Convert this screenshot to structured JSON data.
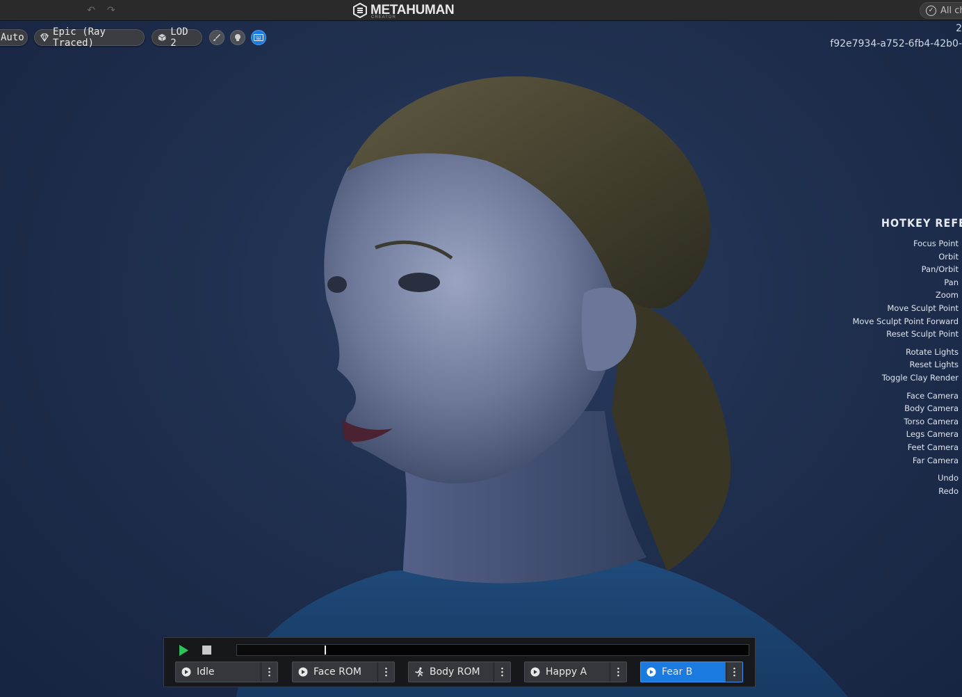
{
  "app": {
    "brand": "METAHUMAN",
    "brand_sub": "CREATOR",
    "save_status": "All ch"
  },
  "toolbar": {
    "render_mode": "Auto",
    "quality": "Epic (Ray Traced)",
    "lod": "LOD 2",
    "icons": [
      "brush-icon",
      "head-icon",
      "keyboard-icon"
    ]
  },
  "viewport": {
    "id_top": "2",
    "asset_id": "f92e7934-a752-6fb4-42b0-"
  },
  "hotkeys": {
    "title": "HOTKEY REFE",
    "groups": [
      [
        "Focus Point",
        "Orbit",
        "Pan/Orbit",
        "Pan",
        "Zoom",
        "Move Sculpt Point",
        "Move Sculpt Point Forward",
        "Reset Sculpt Point"
      ],
      [
        "Rotate Lights",
        "Reset Lights",
        "Toggle Clay Render"
      ],
      [
        "Face Camera",
        "Body Camera",
        "Torso Camera",
        "Legs Camera",
        "Feet Camera",
        "Far Camera"
      ],
      [
        "Undo",
        "Redo"
      ]
    ]
  },
  "player": {
    "progress": 0.173,
    "animations": [
      {
        "label": "Idle",
        "icon": "play-icon",
        "active": false
      },
      {
        "label": "Face ROM",
        "icon": "play-icon",
        "active": false
      },
      {
        "label": "Body ROM",
        "icon": "running-figure-icon",
        "active": false
      },
      {
        "label": "Happy A",
        "icon": "play-icon",
        "active": false
      },
      {
        "label": "Fear B",
        "icon": "play-icon",
        "active": true
      }
    ]
  },
  "colors": {
    "accent": "#1a7ae0",
    "play_green": "#2ec45a",
    "viewport_bg": "#1f2f4e"
  }
}
